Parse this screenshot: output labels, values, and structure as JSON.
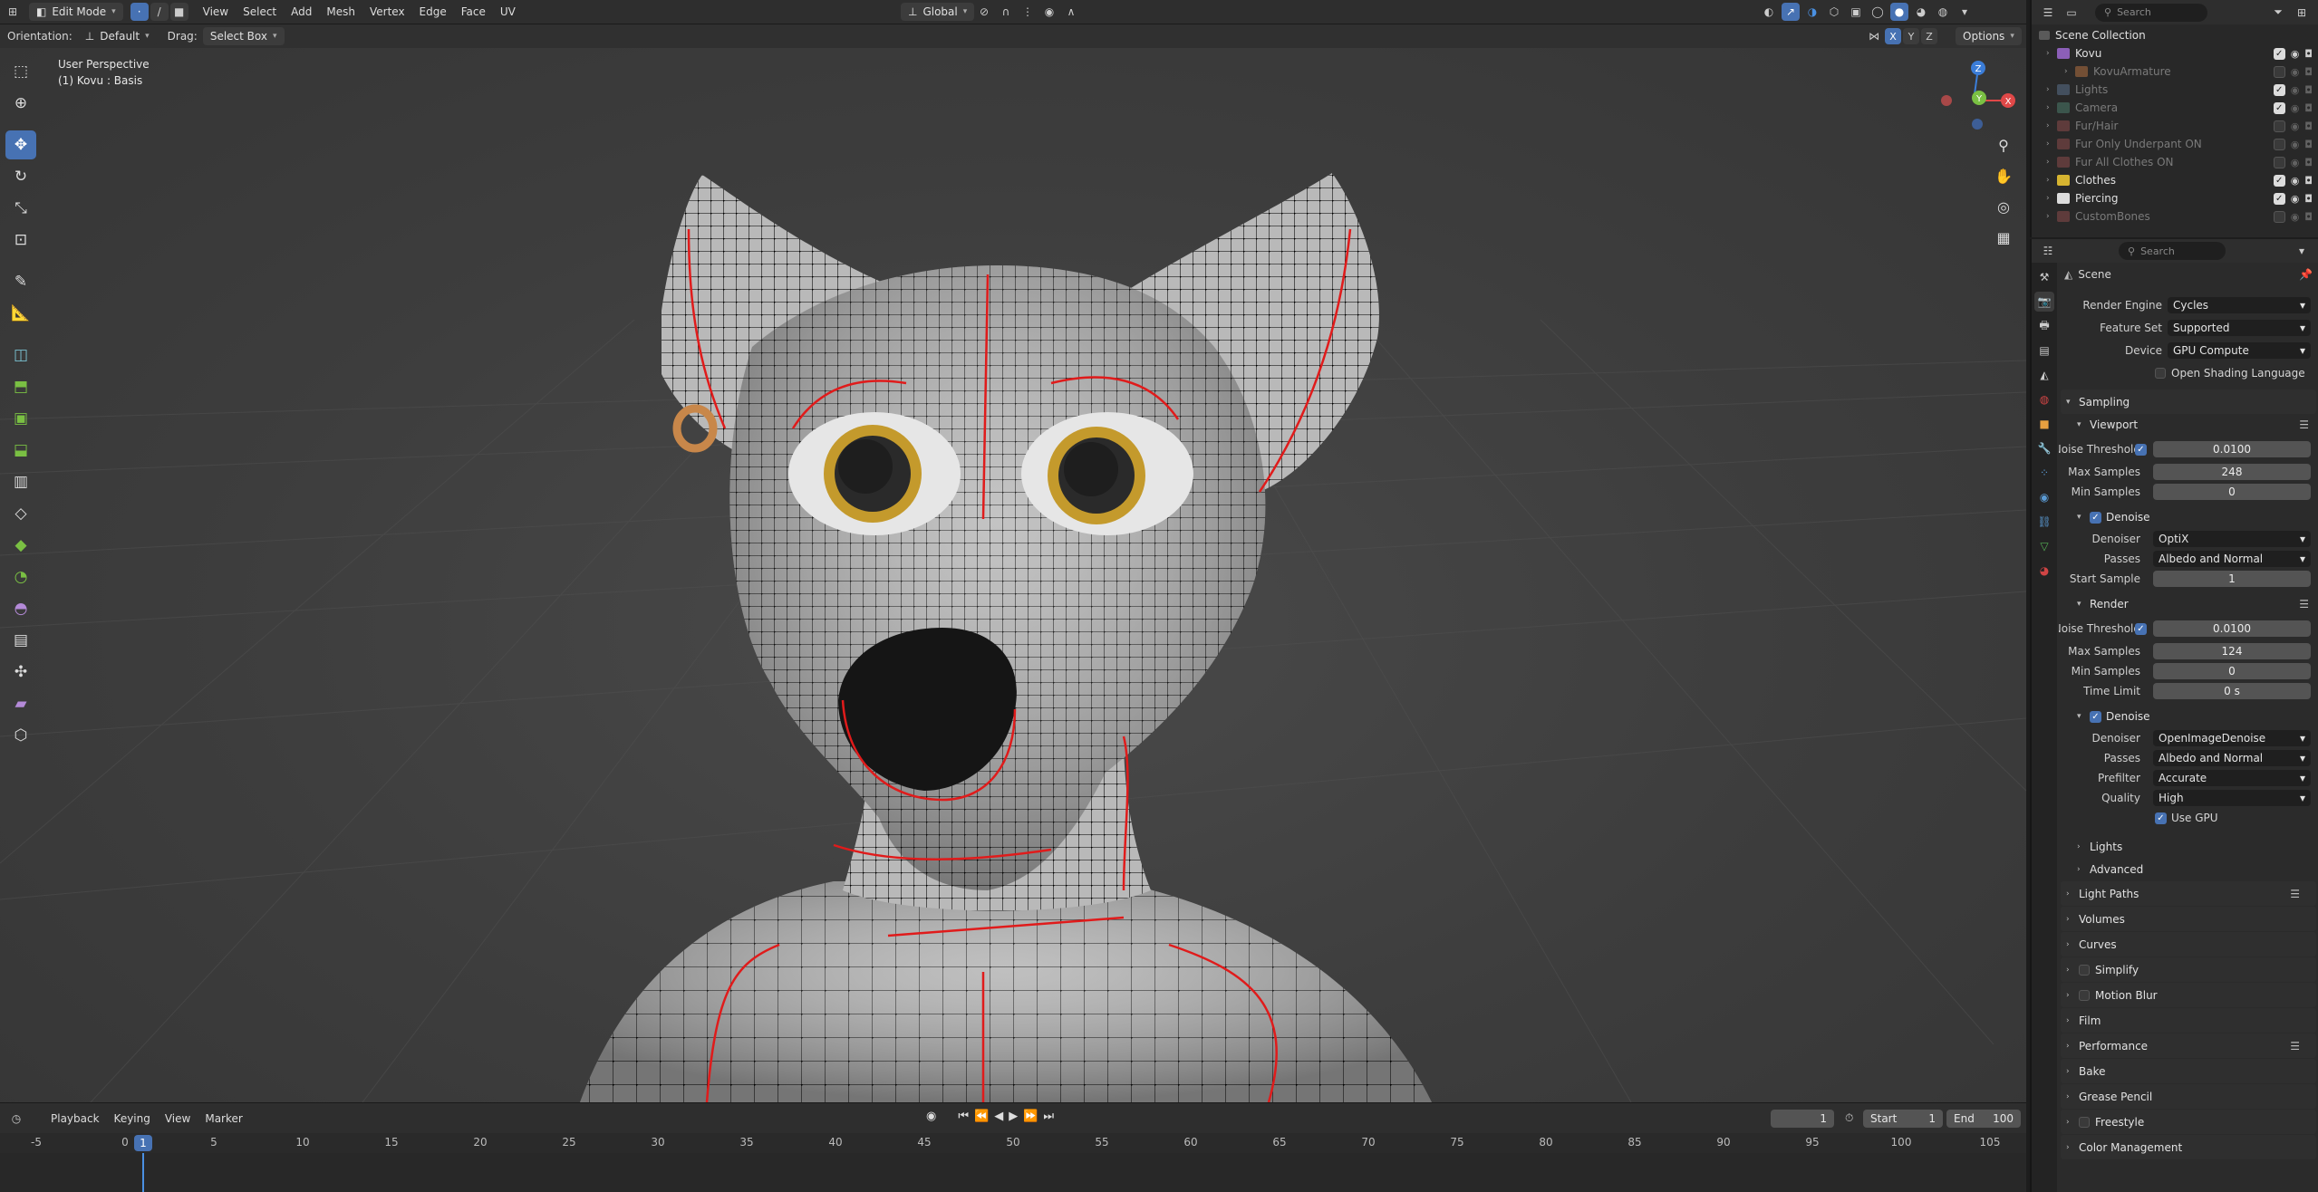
{
  "topbar": {
    "mode": "Edit Mode",
    "menus": [
      "View",
      "Select",
      "Add",
      "Mesh",
      "Vertex",
      "Edge",
      "Face",
      "UV"
    ],
    "transform_orientation": "Global",
    "search_placeholder": "Search"
  },
  "toolheader": {
    "orientation_label": "Orientation:",
    "orientation_value": "Default",
    "drag_label": "Drag:",
    "drag_value": "Select Box",
    "axes": [
      "X",
      "Y",
      "Z"
    ],
    "options_label": "Options"
  },
  "viewport": {
    "perspective": "User Perspective",
    "object": "(1) Kovu : Basis",
    "gizmo_axes": [
      "Z",
      "X",
      "Y"
    ]
  },
  "timeline": {
    "menus": [
      "Playback",
      "Keying",
      "View",
      "Marker"
    ],
    "current_frame": "1",
    "start_label": "Start",
    "start": "1",
    "end_label": "End",
    "end": "100",
    "ruler": [
      "-5",
      "0",
      "5",
      "10",
      "15",
      "20",
      "25",
      "30",
      "35",
      "40",
      "45",
      "50",
      "55",
      "60",
      "65",
      "70",
      "75",
      "80",
      "85",
      "90",
      "95",
      "100",
      "105"
    ],
    "playhead": "1"
  },
  "outliner": {
    "search_placeholder": "Search",
    "root": "Scene Collection",
    "items": [
      {
        "name": "Kovu",
        "dim": false,
        "checked": true,
        "level": 1,
        "color": "#8c5fb8"
      },
      {
        "name": "KovuArmature",
        "dim": true,
        "checked": false,
        "level": 2,
        "color": "#b07040"
      },
      {
        "name": "Lights",
        "dim": true,
        "checked": true,
        "level": 1,
        "color": "#5a6f8a"
      },
      {
        "name": "Camera",
        "dim": true,
        "checked": true,
        "level": 1,
        "color": "#4a7a6a"
      },
      {
        "name": "Fur/Hair",
        "dim": true,
        "checked": false,
        "level": 1,
        "color": "#8a4a4a"
      },
      {
        "name": "Fur Only Underpant ON",
        "dim": true,
        "checked": false,
        "level": 1,
        "color": "#8a4a4a"
      },
      {
        "name": "Fur All Clothes ON",
        "dim": true,
        "checked": false,
        "level": 1,
        "color": "#8a4a4a"
      },
      {
        "name": "Clothes",
        "dim": false,
        "checked": true,
        "level": 1,
        "color": "#d6b430"
      },
      {
        "name": "Piercing",
        "dim": false,
        "checked": true,
        "level": 1,
        "color": "#dcdcdc"
      },
      {
        "name": "CustomBones",
        "dim": true,
        "checked": false,
        "level": 1,
        "color": "#8a4a4a"
      }
    ]
  },
  "properties": {
    "search_placeholder": "Search",
    "context": "Scene",
    "render_engine_label": "Render Engine",
    "render_engine": "Cycles",
    "feature_set_label": "Feature Set",
    "feature_set": "Supported",
    "device_label": "Device",
    "device": "GPU Compute",
    "osl_label": "Open Shading Language",
    "sampling": "Sampling",
    "viewport": "Viewport",
    "noise_threshold_label": "Noise Threshold",
    "vp_noise_threshold": "0.0100",
    "max_samples_label": "Max Samples",
    "vp_max_samples": "248",
    "min_samples_label": "Min Samples",
    "vp_min_samples": "0",
    "denoise_label": "Denoise",
    "denoiser_label": "Denoiser",
    "vp_denoiser": "OptiX",
    "passes_label": "Passes",
    "vp_passes": "Albedo and Normal",
    "start_sample_label": "Start Sample",
    "vp_start_sample": "1",
    "render": "Render",
    "r_noise_threshold": "0.0100",
    "r_max_samples": "124",
    "r_min_samples": "0",
    "time_limit_label": "Time Limit",
    "r_time_limit": "0 s",
    "r_denoiser": "OpenImageDenoise",
    "r_passes": "Albedo and Normal",
    "prefilter_label": "Prefilter",
    "r_prefilter": "Accurate",
    "quality_label": "Quality",
    "r_quality": "High",
    "use_gpu_label": "Use GPU",
    "sub_lights": "Lights",
    "sub_advanced": "Advanced",
    "panels": [
      "Light Paths",
      "Volumes",
      "Curves",
      "Simplify",
      "Motion Blur",
      "Film",
      "Performance",
      "Bake",
      "Grease Pencil",
      "Freestyle",
      "Color Management"
    ]
  }
}
